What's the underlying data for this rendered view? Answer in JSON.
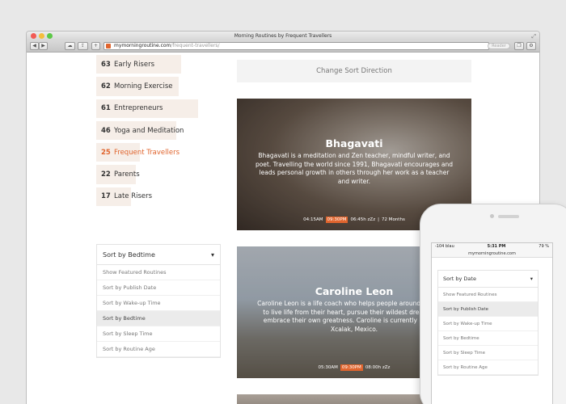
{
  "window": {
    "title": "Morning Routines by Frequent Travellers",
    "url_domain": "mymorningroutine.com",
    "url_path": "/frequent-travellers/",
    "reader_label": "Reader"
  },
  "categories": [
    {
      "count": "63",
      "label": "Early Risers",
      "active": false,
      "share": 0.68
    },
    {
      "count": "62",
      "label": "Morning Exercise",
      "active": false,
      "share": 0.66
    },
    {
      "count": "61",
      "label": "Entrepreneurs",
      "active": false,
      "share": 0.82
    },
    {
      "count": "46",
      "label": "Yoga and Meditation",
      "active": false,
      "share": 0.64
    },
    {
      "count": "25",
      "label": "Frequent Travellers",
      "active": true,
      "share": 0.35
    },
    {
      "count": "22",
      "label": "Parents",
      "active": false,
      "share": 0.32
    },
    {
      "count": "17",
      "label": "Late Risers",
      "active": false,
      "share": 0.28
    }
  ],
  "sort": {
    "selected": "Sort by Bedtime",
    "options": [
      {
        "label": "Show Featured Routines",
        "active": false
      },
      {
        "label": "Sort by Publish Date",
        "active": false
      },
      {
        "label": "Sort by Wake-up Time",
        "active": false
      },
      {
        "label": "Sort by Bedtime",
        "active": true
      },
      {
        "label": "Sort by Sleep Time",
        "active": false
      },
      {
        "label": "Sort by Routine Age",
        "active": false
      }
    ]
  },
  "change_sort_label": "Change Sort Direction",
  "cards": [
    {
      "name": "Bhagavati",
      "description": "Bhagavati is a meditation and Zen teacher, mindful writer, and poet. Travelling the world since 1991, Bhagavati encourages and leads personal growth in others through her work as a teacher and writer.",
      "wake": "04:15AM",
      "bed": "09:30PM",
      "sleep": "06:45h zZz",
      "age": "72 Months"
    },
    {
      "name": "Caroline Leon",
      "description": "Caroline Leon is a life coach who helps people around the world to live life from their heart, pursue their wildest dreams and embrace their own greatness. Caroline is currently based in Xcalak, Mexico.",
      "wake": "05:30AM",
      "bed": "09:30PM",
      "sleep": "08:00h zZz"
    }
  ],
  "phone": {
    "carrier": "-104 blau",
    "time": "5:31 PM",
    "battery": "79 %",
    "url": "mymorningroutine.com",
    "sort_selected": "Sort by Date",
    "options": [
      {
        "label": "Show Featured Routines",
        "active": false
      },
      {
        "label": "Sort by Publish Date",
        "active": true
      },
      {
        "label": "Sort by Wake-up Time",
        "active": false
      },
      {
        "label": "Sort by Bedtime",
        "active": false
      },
      {
        "label": "Sort by Sleep Time",
        "active": false
      },
      {
        "label": "Sort by Routine Age",
        "active": false
      }
    ]
  },
  "colors": {
    "accent": "#e0652e",
    "bar": "#f6eee8"
  },
  "icons": [
    "back-icon",
    "forward-icon",
    "cloud-icon",
    "share-icon",
    "add-tab-icon",
    "reload-icon",
    "tabs-icon",
    "gear-icon",
    "resize-icon",
    "caret-down-icon"
  ]
}
